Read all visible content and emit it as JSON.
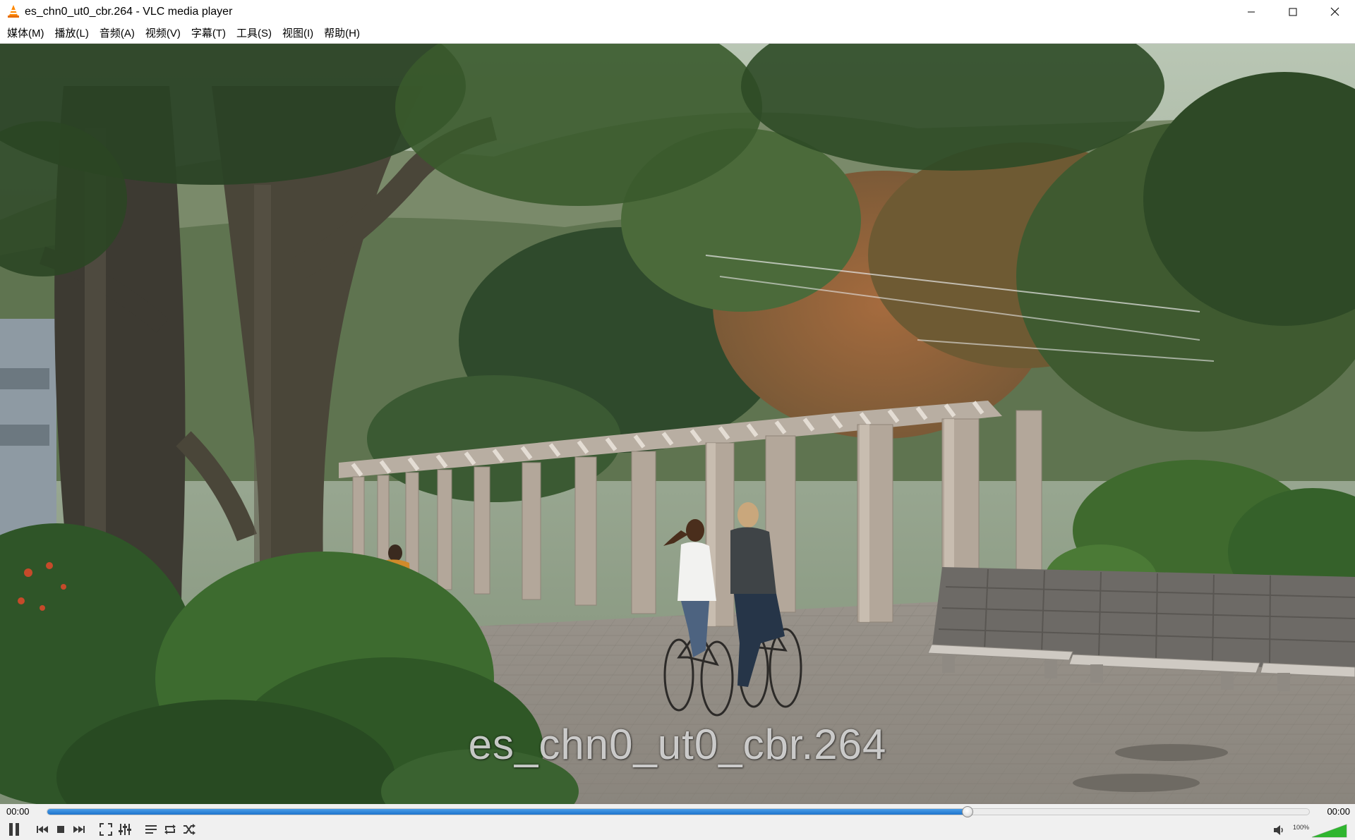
{
  "window": {
    "title": "es_chn0_ut0_cbr.264 - VLC media player",
    "buttons": {
      "minimize": "minimize",
      "maximize": "maximize",
      "close": "close"
    }
  },
  "menubar": {
    "items": [
      {
        "label": "媒体(M)"
      },
      {
        "label": "播放(L)"
      },
      {
        "label": "音频(A)"
      },
      {
        "label": "视频(V)"
      },
      {
        "label": "字幕(T)"
      },
      {
        "label": "工具(S)"
      },
      {
        "label": "视图(I)"
      },
      {
        "label": "帮助(H)"
      }
    ]
  },
  "video": {
    "osd_title": "es_chn0_ut0_cbr.264"
  },
  "controls": {
    "elapsed": "00:00",
    "total": "00:00",
    "seek_progress": 0.729,
    "volume_label": "100%",
    "volume_level": 1.0,
    "buttons": [
      "pause-icon",
      "previous-icon",
      "stop-icon",
      "next-icon",
      "fullscreen-icon",
      "extended-settings-icon",
      "playlist-icon",
      "loop-icon",
      "shuffle-icon"
    ]
  },
  "colors": {
    "accent": "#1e74cc",
    "volume_green": "#2fb52f",
    "vlc_orange": "#ff8800"
  }
}
